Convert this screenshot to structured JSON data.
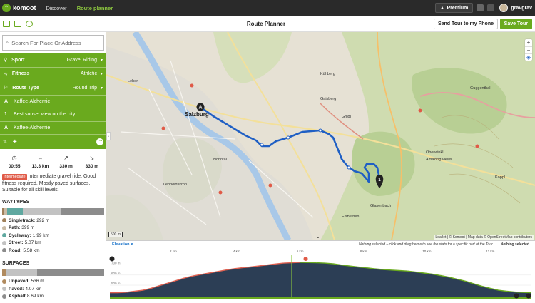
{
  "topbar": {
    "brand": "komoot",
    "nav": [
      "Discover",
      "Route planner"
    ],
    "premium": "Premium",
    "username": "gravgrav"
  },
  "subbar": {
    "title": "Route Planner",
    "send_label": "Send Tour to my Phone",
    "save_label": "Save Tour"
  },
  "sidebar": {
    "search_placeholder": "Search For Place Or Address",
    "settings": [
      {
        "icon": "bike-icon",
        "label": "Sport",
        "value": "Gravel Riding"
      },
      {
        "icon": "fitness-icon",
        "label": "Fitness",
        "value": "Athletic"
      },
      {
        "icon": "route-type-icon",
        "label": "Route Type",
        "value": "Round Trip"
      }
    ],
    "waypoints": [
      {
        "marker": "A",
        "name": "Kaffee-Alchemie"
      },
      {
        "marker": "1",
        "name": "Best sunset view on the city"
      },
      {
        "marker": "A",
        "name": "Kaffee-Alchemie"
      }
    ],
    "stats": [
      {
        "icon": "clock-icon",
        "value": "00:55"
      },
      {
        "icon": "distance-icon",
        "value": "13.3 km"
      },
      {
        "icon": "uphill-icon",
        "value": "330 m"
      },
      {
        "icon": "downhill-icon",
        "value": "330 m"
      }
    ],
    "difficulty_badge": "Intermediate",
    "description": "Intermediate gravel ride. Good fitness required. Mostly paved surfaces. Suitable for all skill levels.",
    "waytypes_title": "WAYTYPES",
    "waytypes": [
      {
        "label": "Singletrack:",
        "value": "292 m",
        "color": "#a0805a",
        "fraction": 0.022
      },
      {
        "label": "Path:",
        "value": "399 m",
        "color": "#c9bba6",
        "fraction": 0.03
      },
      {
        "label": "Cycleway:",
        "value": "1.99 km",
        "color": "#5fa8a0",
        "fraction": 0.15
      },
      {
        "label": "Street:",
        "value": "5.07 km",
        "color": "#c2c2c2",
        "fraction": 0.381
      },
      {
        "label": "Road:",
        "value": "5.58 km",
        "color": "#8c8c8c",
        "fraction": 0.419
      }
    ],
    "surfaces_title": "SURFACES",
    "surfaces": [
      {
        "label": "Unpaved:",
        "value": "536 m",
        "color": "#b08a5e",
        "fraction": 0.04
      },
      {
        "label": "Paved:",
        "value": "4.07 km",
        "color": "#c2c2c2",
        "fraction": 0.306
      },
      {
        "label": "Asphalt",
        "value": "8.69 km",
        "color": "#8c8c8c",
        "fraction": 0.654
      }
    ]
  },
  "map": {
    "labels": [
      {
        "text": "Salzburg",
        "big": true
      },
      {
        "text": "Gaisberg",
        "big": false
      },
      {
        "text": "Oberwinkl",
        "big": false
      },
      {
        "text": "Amazing views",
        "big": false
      },
      {
        "text": "Kühberg",
        "big": false
      },
      {
        "text": "Lehen",
        "big": false
      },
      {
        "text": "Gnigl",
        "big": false
      },
      {
        "text": "Nonntal",
        "big": false
      },
      {
        "text": "Leopoldskron",
        "big": false
      },
      {
        "text": "Guggenthal",
        "big": false
      },
      {
        "text": "Koppl",
        "big": false
      },
      {
        "text": "Elsbethen",
        "big": false
      },
      {
        "text": "Glasenbach",
        "big": false
      }
    ],
    "scale": "500 m",
    "attribution": "Leaflet | © Komoot | Map data © OpenStreetMap contributors"
  },
  "elevation": {
    "title": "Elevation",
    "message": "Nothing selected – click and drag below to see the stats for a specific part of the Tour.",
    "selection": "Nothing selected",
    "km_labels": [
      "2 km",
      "4 km",
      "6 km",
      "8 km",
      "10 km",
      "12 km"
    ],
    "y_labels": [
      "700 m",
      "600 m",
      "500 m",
      "400 m"
    ],
    "profile_m": [
      425,
      425,
      430,
      440,
      450,
      470,
      495,
      520,
      545,
      570,
      590,
      605,
      620,
      635,
      650,
      662,
      672,
      680,
      690,
      700,
      710,
      718,
      722,
      725,
      724,
      722,
      718,
      712,
      700,
      690,
      680,
      672,
      662,
      655,
      650,
      645,
      640,
      630,
      620,
      610,
      595,
      580,
      560,
      540,
      515,
      490,
      470,
      450,
      440,
      432,
      428,
      425
    ]
  }
}
